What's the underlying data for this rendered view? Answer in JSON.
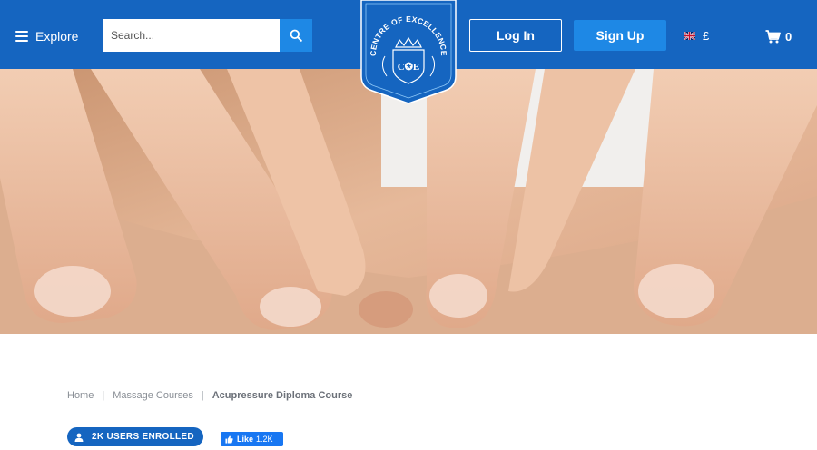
{
  "header": {
    "explore_label": "Explore",
    "search_placeholder": "Search...",
    "login_label": "Log In",
    "signup_label": "Sign Up",
    "currency_symbol": "£",
    "cart_count": "0",
    "logo_text_top": "CENTRE OF EXCELLENCE",
    "logo_monogram": "C✪E"
  },
  "breadcrumb": {
    "home": "Home",
    "separator": "|",
    "category": "Massage Courses",
    "current": "Acupressure Diploma Course"
  },
  "course": {
    "enrolled_label": "2K USERS ENROLLED",
    "like_label": "Like",
    "like_count": "1.2K"
  },
  "colors": {
    "brand_blue": "#1565c0",
    "accent_blue": "#1e88e5",
    "facebook_blue": "#1877f2"
  }
}
